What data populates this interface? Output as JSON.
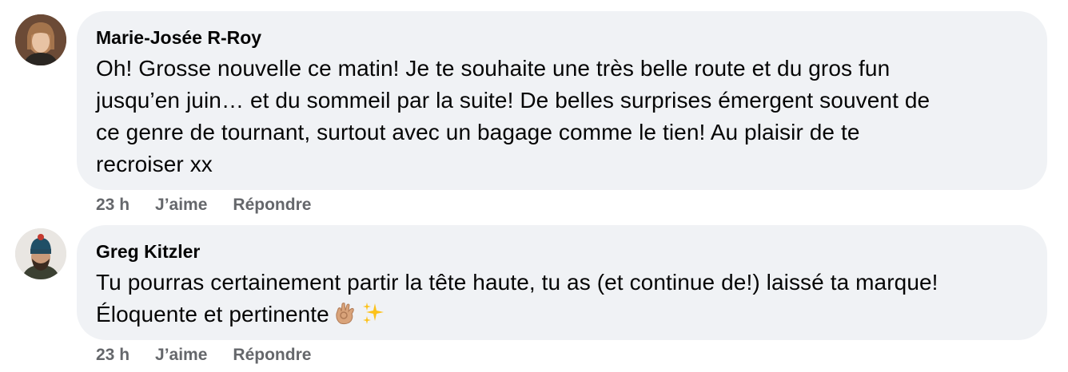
{
  "comments": [
    {
      "author": "Marie-Josée R-Roy",
      "text_lines": [
        "Oh! Grosse nouvelle ce matin! Je te souhaite une très belle route et du gros fun",
        "jusqu’en juin… et du sommeil par la suite! De belles surprises émergent souvent de",
        "ce genre de tournant, surtout avec un bagage comme le tien! Au plaisir de te",
        "recroiser xx"
      ],
      "time": "23 h",
      "like_label": "J’aime",
      "reply_label": "Répondre"
    },
    {
      "author": "Greg Kitzler",
      "text_lines": [
        "Tu pourras certainement partir la tête haute, tu as (et continue de!) laissé ta marque!",
        "Éloquente et pertinente"
      ],
      "emojis": [
        "ok-hand-emoji",
        "sparkles-emoji"
      ],
      "time": "23 h",
      "like_label": "J’aime",
      "reply_label": "Répondre"
    }
  ],
  "colors": {
    "bubble_bg": "#f0f2f5",
    "text": "#050505",
    "secondary_text": "#65676b"
  }
}
